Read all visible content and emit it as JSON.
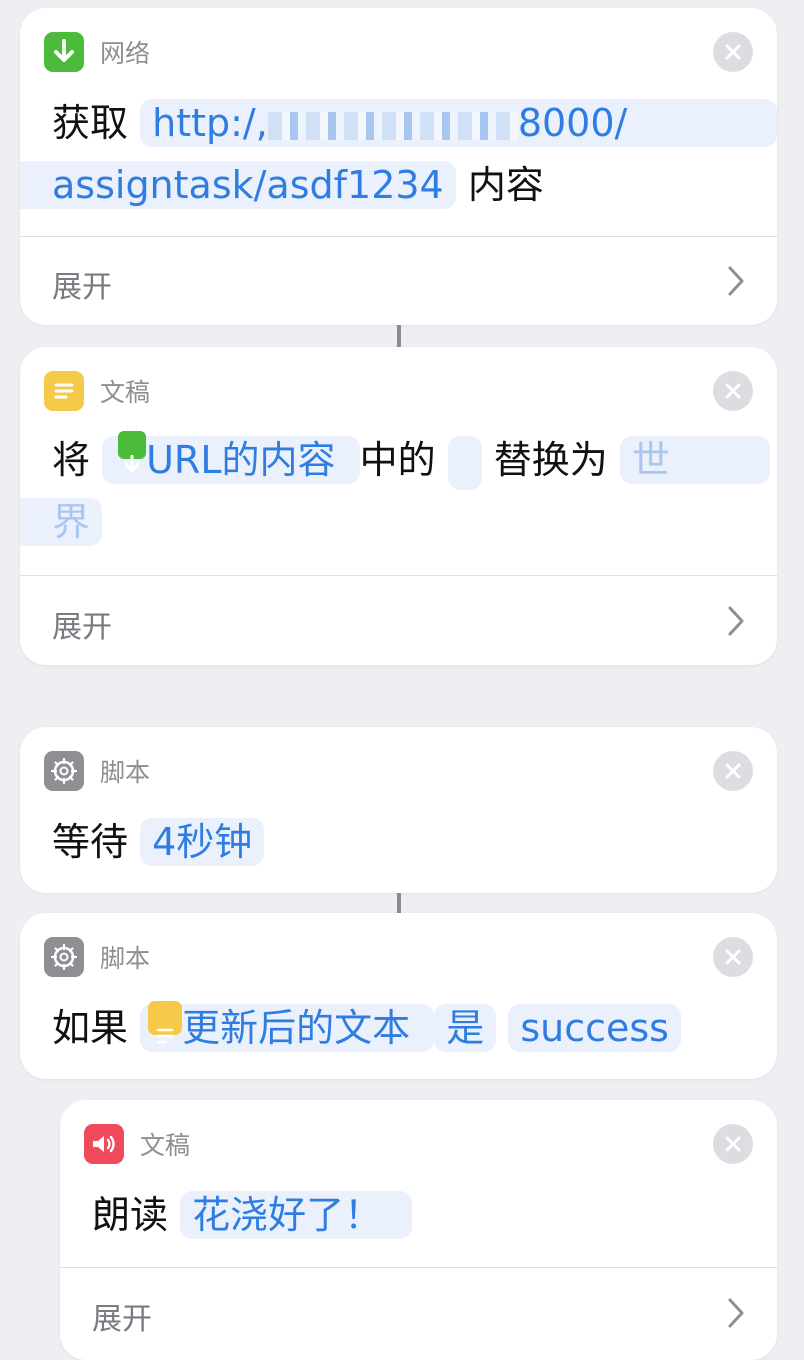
{
  "actions": [
    {
      "category": "网络",
      "prefix": "获取",
      "url_part1": "http:/,",
      "url_masked": "",
      "url_part2": "8000/",
      "url_line2": "assigntask/asdf1234",
      "suffix": "内容",
      "expand_label": "展开",
      "icon": "download-icon",
      "color": "#4cba3b"
    },
    {
      "category": "文稿",
      "prefix": "将",
      "variable": "URL的内容",
      "middle": "中的",
      "search_value": "",
      "replace_label": "替换为",
      "replace_part1": "世",
      "replace_part2": "界",
      "expand_label": "展开",
      "icon": "text-doc-icon",
      "color": "#f7c948"
    },
    {
      "category": "脚本",
      "prefix": "等待",
      "value": "4秒钟",
      "icon": "gear-icon",
      "color": "#8e8e93"
    },
    {
      "category": "脚本",
      "prefix": "如果",
      "variable": "更新后的文本",
      "condition": "是",
      "value": "success",
      "icon": "gear-icon",
      "color": "#8e8e93"
    },
    {
      "category": "文稿",
      "prefix": "朗读",
      "value": "花浇好了！",
      "expand_label": "展开",
      "icon": "speaker-icon",
      "color": "#ef4a5b"
    }
  ]
}
